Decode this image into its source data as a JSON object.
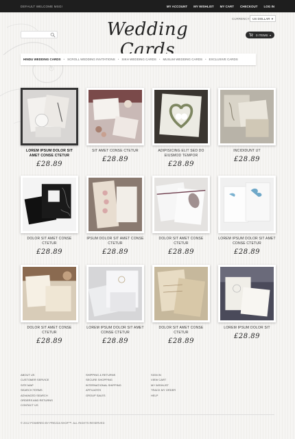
{
  "topbar": {
    "welcome": "DEFAULT WELCOME MSG!",
    "links": [
      "MY ACCOUNT",
      "MY WISHLIST",
      "MY CART",
      "CHECKOUT",
      "LOG IN"
    ]
  },
  "header": {
    "logo": "Wedding Cards",
    "tagline": "THE BIGGEST CHOICE ON THE WEB",
    "search_placeholder": "",
    "currency_label": "CURRENCY:",
    "currency_value": "US DOLLAR",
    "cart_count": "0 ITEMS"
  },
  "nav": {
    "items": [
      "HINDU WEDDING CARDS",
      "SCROLL WEDDING INVITATIONS",
      "SIKH WEDDING CARDS",
      "MUSLIM WEDDING CARDS",
      "EXCLUSIVE CARDS"
    ]
  },
  "products": [
    {
      "name": "LOREM IPSUM DOLOR SIT AMET CONSE CTETUR",
      "price": "£28.89"
    },
    {
      "name": "SIT AMET CONSE CTETUR",
      "price": "£28.89"
    },
    {
      "name": "ADIPISICING ELIT SED DO EIUSMOD TEMPOR",
      "price": "£28.89"
    },
    {
      "name": "INCIDIDUNT UT",
      "price": "£28.89"
    },
    {
      "name": "DOLOR SIT AMET CONSE CTETUR",
      "price": "£28.89"
    },
    {
      "name": "IPSUM DOLOR SIT AMET CONSE CTETUR",
      "price": "£28.89"
    },
    {
      "name": "DOLOR SIT AMET CONSE CTETUR",
      "price": "£28.89"
    },
    {
      "name": "LOREM IPSUM DOLOR SIT AMET CONSE CTETUR",
      "price": "£28.89"
    },
    {
      "name": "DOLOR SIT AMET CONSE CTETUR",
      "price": "£28.89"
    },
    {
      "name": "LOREM IPSUM DOLOR SIT AMET CONSE CTETUR",
      "price": "£28.89"
    },
    {
      "name": "DOLOR SIT AMET CONSE CTETUR",
      "price": "£28.89"
    },
    {
      "name": "LOREM IPSUM DOLOR SIT",
      "price": "£28.89"
    }
  ],
  "footer": {
    "col1": [
      "ABOUT US",
      "CUSTOMER SERVICE",
      "SITE MAP",
      "SEARCH TERMS",
      "ADVANCED SEARCH",
      "ORDERS AND RETURNS",
      "CONTACT US"
    ],
    "col2": [
      "SHIPPING & RETURNS",
      "SECURE SHOPPING",
      "INTERNATIONAL SHIPPING",
      "AFFILIATES",
      "GROUP SALES"
    ],
    "col3": [
      "SIGN IN",
      "VIEW CART",
      "MY WISHLIST",
      "TRACK MY ORDER",
      "HELP"
    ],
    "copyright": "© 2012 POWERED BY PREZZA SHOP™. ALL RIGHTS RESERVED"
  },
  "colors": {
    "topbar": "#1e1e1e",
    "background": "#f4f3f1",
    "accent": "#222222"
  }
}
